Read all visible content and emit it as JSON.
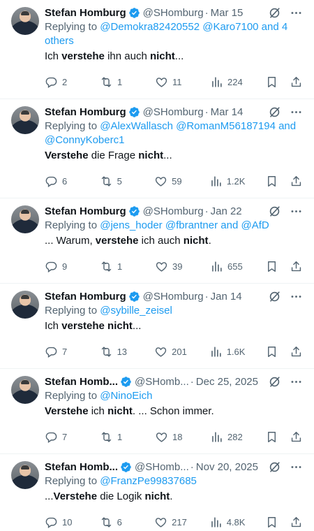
{
  "replying_prefix": "Replying to",
  "tweets": [
    {
      "name": "Stefan Homburg",
      "handle": "@SHomburg",
      "date": "Mar 15",
      "mentions": [
        "@Demokra82420552",
        "@Karo7100 and 4 others"
      ],
      "text": [
        [
          "Ich ",
          ""
        ],
        [
          "verstehe",
          "b"
        ],
        [
          " ihn auch ",
          ""
        ],
        [
          "nicht",
          "b"
        ],
        [
          "...",
          ""
        ]
      ],
      "replies": "2",
      "reposts": "1",
      "likes": "11",
      "views": "224"
    },
    {
      "name": "Stefan Homburg",
      "handle": "@SHomburg",
      "date": "Mar 14",
      "mentions": [
        "@AlexWallasch",
        "@RomanM56187194 and",
        "@ConnyKoberc1"
      ],
      "text": [
        [
          "Verstehe",
          "b"
        ],
        [
          " die Frage ",
          ""
        ],
        [
          "nicht",
          "b"
        ],
        [
          "...",
          ""
        ]
      ],
      "replies": "6",
      "reposts": "5",
      "likes": "59",
      "views": "1.2K"
    },
    {
      "name": "Stefan Homburg",
      "handle": "@SHomburg",
      "date": "Jan 22",
      "mentions": [
        "@jens_hoder",
        "@fbrantner and @AfD"
      ],
      "text": [
        [
          "... Warum, ",
          ""
        ],
        [
          "verstehe",
          "b"
        ],
        [
          " ich auch ",
          ""
        ],
        [
          "nicht",
          "b"
        ],
        [
          ".",
          ""
        ]
      ],
      "replies": "9",
      "reposts": "1",
      "likes": "39",
      "views": "655"
    },
    {
      "name": "Stefan Homburg",
      "handle": "@SHomburg",
      "date": "Jan 14",
      "mentions": [
        "@sybille_zeisel"
      ],
      "text": [
        [
          "Ich ",
          ""
        ],
        [
          "verstehe nicht",
          "b"
        ],
        [
          "...",
          ""
        ]
      ],
      "replies": "7",
      "reposts": "13",
      "likes": "201",
      "views": "1.6K"
    },
    {
      "name": "Stefan Homb...",
      "handle": "@SHomb...",
      "date": "Dec 25, 2025",
      "mentions": [
        "@NinoEich"
      ],
      "text": [
        [
          "Verstehe",
          "b"
        ],
        [
          " ich ",
          ""
        ],
        [
          "nicht",
          "b"
        ],
        [
          ". ... Schon immer.",
          ""
        ]
      ],
      "replies": "7",
      "reposts": "1",
      "likes": "18",
      "views": "282"
    },
    {
      "name": "Stefan Homb...",
      "handle": "@SHomb...",
      "date": "Nov 20, 2025",
      "mentions": [
        "@FranzPe99837685"
      ],
      "text": [
        [
          "...",
          ""
        ],
        [
          "Verstehe",
          "b"
        ],
        [
          " die Logik ",
          ""
        ],
        [
          "nicht",
          "b"
        ],
        [
          ".",
          ""
        ]
      ],
      "replies": "10",
      "reposts": "6",
      "likes": "217",
      "views": "4.8K"
    }
  ],
  "colors": {
    "accent": "#1d9bf0",
    "muted": "#536471",
    "text": "#0f1419",
    "border": "#eff3f4"
  },
  "icons": [
    "verified-badge-icon",
    "grok-icon",
    "more-icon",
    "reply-icon",
    "repost-icon",
    "like-icon",
    "views-icon",
    "bookmark-icon",
    "share-icon"
  ]
}
